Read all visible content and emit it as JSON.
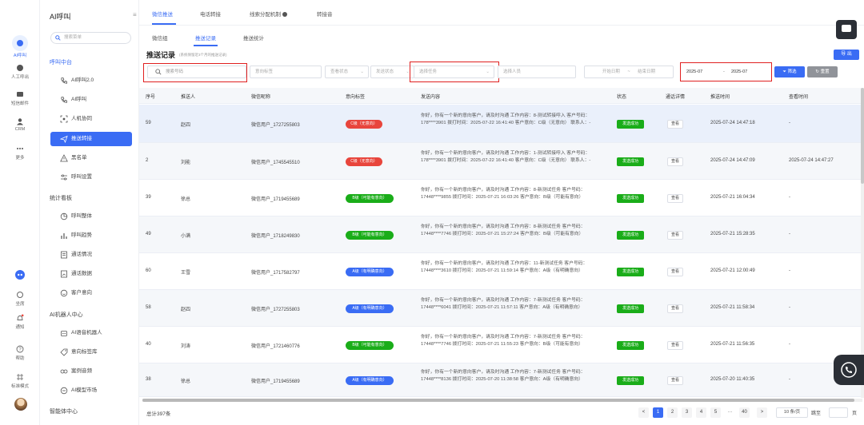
{
  "rail": {
    "items": [
      {
        "label": "AI呼叫"
      },
      {
        "label": "人工呼出"
      },
      {
        "label": "短信邮件"
      },
      {
        "label": "CRM"
      },
      {
        "label": "更多"
      }
    ],
    "bottom": [
      {
        "label": "坐席"
      },
      {
        "label": "通知"
      },
      {
        "label": "帮助"
      },
      {
        "label": "标准模式"
      }
    ]
  },
  "sidebar": {
    "title": "AI呼叫",
    "search_placeholder": "搜索菜单",
    "group1": "呼叫中台",
    "items1": [
      "AI呼叫2.0",
      "AI呼叫",
      "人机协同",
      "推送转接",
      "黑名单",
      "呼叫设置"
    ],
    "group2": "统计看板",
    "items2": [
      "呼叫整体",
      "呼叫趋势",
      "通话情况",
      "通话数据",
      "客户意向"
    ],
    "group3": "AI机器人中心",
    "items3": [
      "AI语音机器人",
      "意向标签库",
      "案例音频",
      "AI模型市场"
    ],
    "group4": "智能体中心"
  },
  "tabs": [
    "微信推送",
    "电话转接",
    "线索分配机制",
    "转接音"
  ],
  "subtabs": [
    "微信组",
    "推送记录",
    "推送统计"
  ],
  "page": {
    "title": "推送记录",
    "hint": "(系统保留近3个月的推送记录)",
    "export_label": "导 出"
  },
  "filters": {
    "search_placeholder": "搜索号码",
    "intent_placeholder": "意向标签",
    "view_status_placeholder": "查看状态",
    "send_status_placeholder": "发送状态",
    "task_placeholder": "选择任务",
    "person_placeholder": "选择人员",
    "start_date_placeholder": "开始日期",
    "end_date_placeholder": "结束日期",
    "range_sep": "~",
    "month_start": "2025-07",
    "month_sep": "-",
    "month_end": "2025-07",
    "filter_label": "筛选",
    "reset_label": "重置"
  },
  "table": {
    "columns": [
      "序号",
      "推送人",
      "微信昵称",
      "意向标签",
      "发送内容",
      "状态",
      "通话详情",
      "推送时间",
      "查看时间"
    ],
    "view_label": "查看",
    "rows": [
      {
        "id": "59",
        "pusher": "赵四",
        "nick": "微信用户_1727255803",
        "tag": "C级（无意向）",
        "tag_color": "#e8453c",
        "content": "你好，你有一个新的意向客户，请及时沟通 工作内容：8-测试转接呼入 客户号码：178****3901 拨打时间：2025-07-22 16:41:40 客户意向：C级（无意向） 联系人：-",
        "status": "发送成功",
        "push_time": "2025-07-24 14:47:18",
        "view_time": "-"
      },
      {
        "id": "2",
        "pusher": "刘能",
        "nick": "微信用户_1745545510",
        "tag": "C级（无意向）",
        "tag_color": "#e8453c",
        "content": "你好，你有一个新的意向客户，请及时沟通 工作内容：1-测试转接呼入 客户号码：178****3901 拨打时间：2025-07-22 16:41:40 客户意向：C级（无意向） 联系人：-",
        "status": "发送成功",
        "push_time": "2025-07-24 14:47:09",
        "view_time": "2025-07-24 14:47:27"
      },
      {
        "id": "39",
        "pusher": "徐总",
        "nick": "微信用户_1719455689",
        "tag": "B级（可能有意向）",
        "tag_color": "#1aad19",
        "content": "你好，你有一个新的意向客户，请及时沟通 工作内容：8-新测试任务 客户号码：17448****9855 拨打时间：2025-07-21 16:03:26 客户意向：B级（可能有意向）",
        "status": "发送成功",
        "push_time": "2025-07-21 16:04:34",
        "view_time": "-"
      },
      {
        "id": "49",
        "pusher": "小满",
        "nick": "微信用户_1718249830",
        "tag": "B级（可能有意向）",
        "tag_color": "#1aad19",
        "content": "你好，你有一个新的意向客户，请及时沟通 工作内容：8-新测试任务 客户号码：17448****7746 拨打时间：2025-07-21 15:27:24 客户意向：B级（可能有意向）",
        "status": "发送成功",
        "push_time": "2025-07-21 15:28:35",
        "view_time": "-"
      },
      {
        "id": "60",
        "pusher": "王雪",
        "nick": "微信用户_1717582797",
        "tag": "A级（有明确意向）",
        "tag_color": "#3a6cf4",
        "content": "你好，你有一个新的意向客户，请及时沟通 工作内容：11-新测试任务 客户号码：17448****3610 拨打时间：2025-07-21 11:59:14 客户意向：A级（有明确意向）",
        "status": "发送成功",
        "push_time": "2025-07-21 12:00:49",
        "view_time": "-"
      },
      {
        "id": "58",
        "pusher": "赵四",
        "nick": "微信用户_1727255803",
        "tag": "A级（有明确意向）",
        "tag_color": "#3a6cf4",
        "content": "你好，你有一个新的意向客户，请及时沟通 工作内容：7-新测试任务 客户号码：17448****6041 拨打时间：2025-07-21 11:57:11 客户意向：A级（有明确意向）",
        "status": "发送成功",
        "push_time": "2025-07-21 11:58:34",
        "view_time": "-"
      },
      {
        "id": "40",
        "pusher": "刘涛",
        "nick": "微信用户_1721460776",
        "tag": "B级（可能有意向）",
        "tag_color": "#1aad19",
        "content": "你好，你有一个新的意向客户，请及时沟通 工作内容：7-新测试任务 客户号码：17448****7746 拨打时间：2025-07-21 11:55:23 客户意向：B级（可能有意向）",
        "status": "发送成功",
        "push_time": "2025-07-21 11:56:35",
        "view_time": "-"
      },
      {
        "id": "38",
        "pusher": "徐总",
        "nick": "微信用户_1719455689",
        "tag": "A级（有明确意向）",
        "tag_color": "#3a6cf4",
        "content": "你好，你有一个新的意向客户，请及时沟通 工作内容：7-新测试任务 客户号码：17448****8136 拨打时间：2025-07-20 11:38:58 客户意向：A级（有明确意向）",
        "status": "发送成功",
        "push_time": "2025-07-20 11:40:35",
        "view_time": "-"
      }
    ]
  },
  "footer": {
    "total": "总计397条",
    "pages": [
      "1",
      "2",
      "3",
      "4",
      "5",
      "···",
      "40"
    ],
    "prev": "<",
    "next": ">",
    "page_size": "10 条/页",
    "jump_label": "跳至",
    "unit": "页"
  },
  "colors": {
    "accent": "#3a6cf4",
    "success": "#1aad19",
    "danger": "#e8453c",
    "highlight_box": "#e02020"
  }
}
